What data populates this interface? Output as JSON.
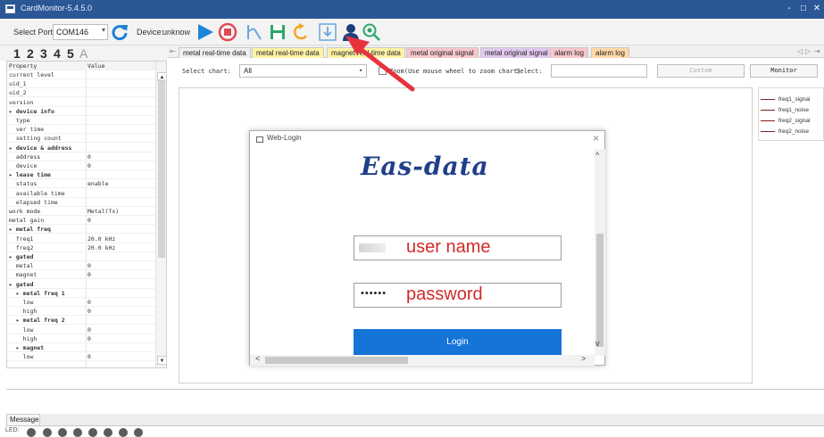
{
  "window": {
    "title": "CardMonitor-5.4.5.0",
    "controls": [
      "-",
      "□",
      "✕"
    ]
  },
  "toolbar": {
    "port_label": "Select Port:",
    "port_value": "COM146",
    "device_label": "Device:",
    "device_value": "unknow"
  },
  "numbers": [
    "1",
    "2",
    "3",
    "4",
    "5",
    "A"
  ],
  "tabs": [
    {
      "label": "metal real-time data",
      "color": "#f0f0f0"
    },
    {
      "label": "metal real-time data",
      "color": "#fff3a6"
    },
    {
      "label": "magnet real-time data",
      "color": "#fff3a6"
    },
    {
      "label": "metal original signal",
      "color": "#f7c7cc"
    },
    {
      "label": "metal original signal",
      "color": "#e2c9ef"
    },
    {
      "label": "alarm log",
      "color": "#f7c7cc"
    },
    {
      "label": "alarm log",
      "color": "#ffd9a8"
    }
  ],
  "properties": {
    "headers": {
      "property": "Property",
      "value": "Value"
    },
    "rows": [
      {
        "k": "current level",
        "v": ""
      },
      {
        "k": "uid_1",
        "v": ""
      },
      {
        "k": "uid_2",
        "v": ""
      },
      {
        "k": "version",
        "v": ""
      },
      {
        "k": "▸ device info",
        "v": "",
        "group": true
      },
      {
        "k": "  type",
        "v": ""
      },
      {
        "k": "  ver time",
        "v": ""
      },
      {
        "k": "  setting count",
        "v": ""
      },
      {
        "k": "▸ device & address",
        "v": "",
        "group": true
      },
      {
        "k": "  address",
        "v": "0"
      },
      {
        "k": "  device",
        "v": "0"
      },
      {
        "k": "▸ lease time",
        "v": "",
        "group": true
      },
      {
        "k": "  status",
        "v": "enable"
      },
      {
        "k": "  available time",
        "v": ""
      },
      {
        "k": "  elapsed time",
        "v": ""
      },
      {
        "k": "work mode",
        "v": "Metal(Tx)"
      },
      {
        "k": "metal gain",
        "v": "0"
      },
      {
        "k": "▸ metal freq",
        "v": "",
        "group": true
      },
      {
        "k": "  freq1",
        "v": "20.0 kHz"
      },
      {
        "k": "  freq2",
        "v": "20.0 kHz"
      },
      {
        "k": "▸ gated",
        "v": "",
        "group": true
      },
      {
        "k": "  metal",
        "v": "0"
      },
      {
        "k": "  magnet",
        "v": "0"
      },
      {
        "k": "▸ gated",
        "v": "",
        "group": true
      },
      {
        "k": "  ▸ metal freq 1",
        "v": "",
        "group": true
      },
      {
        "k": "    low",
        "v": "0"
      },
      {
        "k": "    high",
        "v": "0"
      },
      {
        "k": "  ▸ metal freq 2",
        "v": "",
        "group": true
      },
      {
        "k": "    low",
        "v": "0"
      },
      {
        "k": "    high",
        "v": "0"
      },
      {
        "k": "  ▸ magnet",
        "v": "",
        "group": true
      },
      {
        "k": "    low",
        "v": "0"
      }
    ]
  },
  "filter": {
    "select_chart_label": "Select chart:",
    "select_chart_value": "All",
    "zoom_text": "Zoom(Use mouse wheel to zoom chart)",
    "select_label": "Select:",
    "select_value": "",
    "custom_label": "Custom",
    "monitor_label": "Monitor"
  },
  "legend": [
    "freq1_signal",
    "freq1_noise",
    "freq2_signal",
    "freq2_noise"
  ],
  "legend_color": "#8b1a1a",
  "message_tab": "Message",
  "led_label": "LED:",
  "dialog": {
    "title": "Web-Login",
    "close": "×",
    "brand": "Eas-data",
    "username_placeholder": "user name",
    "password_placeholder": "password",
    "password_mask": "••••••",
    "login_label": "Login"
  },
  "colors": {
    "titlebar": "#2b5797",
    "login": "#1474d8",
    "annotation": "#e8323c",
    "brand": "#1f3f8a"
  }
}
